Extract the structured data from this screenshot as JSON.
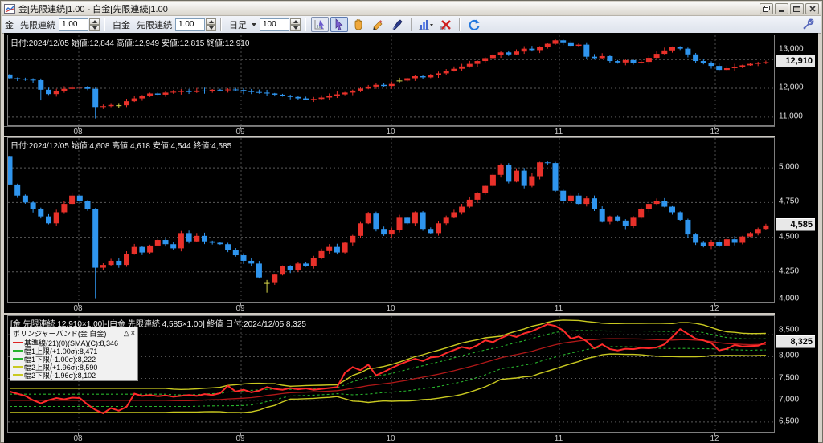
{
  "window": {
    "title": "金[先限連続]1.00 - 白金[先限連続]1.00"
  },
  "toolbar": {
    "gold_label": "金",
    "gold_series": "先限連続",
    "gold_mult": "1.00",
    "plat_label": "白金",
    "plat_series": "先限連続",
    "plat_mult": "1.00",
    "period_label": "日足",
    "bar_count": "100"
  },
  "colors": {
    "up": "#e8312a",
    "down": "#2f95ee",
    "doji": "#d6d64a",
    "spread": "#ff2a2a",
    "sma": "#b01818",
    "band1": "#27b32c",
    "band2": "#c9c920",
    "grid": "#5a5a5a",
    "monthline": "#4a4a4a"
  },
  "chart_data": [
    {
      "type": "candlestick",
      "title": "金 先限連続 日足",
      "info": "日付:2024/12/05 始値:12,844 高値:12,949 安値:12,815 終値:12,910",
      "last_price": 12910,
      "last_price_label": "12,910",
      "ylim": [
        10660,
        13845
      ],
      "y_ticks": [
        {
          "v": 13000,
          "label": "13,000"
        },
        {
          "v": 12000,
          "label": "12,000"
        },
        {
          "v": 11000,
          "label": "11,000"
        }
      ],
      "x_ticks": [
        "08",
        "09",
        "10",
        "11",
        "12"
      ],
      "open_first": 12480,
      "closes": [
        12350,
        12330,
        12300,
        12280,
        11950,
        11800,
        11900,
        11980,
        12020,
        12050,
        11980,
        11350,
        11380,
        11420,
        11410,
        11550,
        11650,
        11750,
        11820,
        11780,
        11850,
        11880,
        11900,
        11870,
        11920,
        11900,
        11950,
        11930,
        11960,
        11940,
        11900,
        11870,
        11850,
        11820,
        11780,
        11740,
        11700,
        11650,
        11600,
        11630,
        11680,
        11730,
        11790,
        11850,
        11920,
        11990,
        12060,
        12120,
        12080,
        12150,
        12270,
        12350,
        12420,
        12380,
        12450,
        12520,
        12600,
        12680,
        12760,
        12850,
        12950,
        13050,
        13150,
        13250,
        13180,
        13280,
        13380,
        13330,
        13450,
        13550,
        13670,
        13600,
        13480,
        13520,
        13100,
        13050,
        13120,
        12950,
        12900,
        12980,
        12890,
        12920,
        13060,
        13200,
        13320,
        13440,
        13380,
        13180,
        12950,
        12870,
        12780,
        12640,
        12700,
        12750,
        12800,
        12850,
        12880,
        12910
      ],
      "dojis": [
        14,
        50
      ],
      "low_overrides": {
        "4": 11580,
        "11": 10950
      },
      "wick_amp": 90
    },
    {
      "type": "candlestick",
      "title": "白金 先限連続 日足",
      "info": "日付:2024/12/05 始値:4,608 高値:4,618 安値:4,544 終値:4,585",
      "last_price": 4585,
      "last_price_label": "4,585",
      "ylim": [
        4023,
        5215
      ],
      "y_ticks": [
        {
          "v": 5000,
          "label": "5,000"
        },
        {
          "v": 4750,
          "label": "4,750"
        },
        {
          "v": 4500,
          "label": "4,500"
        },
        {
          "v": 4250,
          "label": "4,250"
        },
        {
          "v": 4000,
          "label": "4,000"
        }
      ],
      "x_ticks": [
        "08",
        "09",
        "10",
        "11",
        "12"
      ],
      "open_first": 5080,
      "closes": [
        4880,
        4800,
        4750,
        4700,
        4650,
        4600,
        4680,
        4740,
        4800,
        4760,
        4700,
        4280,
        4300,
        4330,
        4300,
        4380,
        4430,
        4390,
        4440,
        4480,
        4450,
        4420,
        4530,
        4470,
        4510,
        4470,
        4460,
        4450,
        4410,
        4370,
        4330,
        4310,
        4210,
        4170,
        4230,
        4290,
        4260,
        4310,
        4290,
        4350,
        4400,
        4430,
        4390,
        4460,
        4510,
        4600,
        4670,
        4560,
        4520,
        4550,
        4640,
        4600,
        4680,
        4560,
        4530,
        4600,
        4640,
        4680,
        4720,
        4770,
        4820,
        4870,
        4950,
        5020,
        4900,
        4980,
        4870,
        4940,
        5040,
        5035,
        4835,
        4760,
        4800,
        4740,
        4780,
        4700,
        4610,
        4650,
        4620,
        4580,
        4640,
        4700,
        4740,
        4760,
        4720,
        4680,
        4625,
        4520,
        4460,
        4435,
        4465,
        4440,
        4485,
        4460,
        4505,
        4530,
        4560,
        4585
      ],
      "dojis": [
        33
      ],
      "low_overrides": {
        "11": 4060,
        "33": 4100
      },
      "wick_amp": 20
    },
    {
      "type": "line",
      "title": "金-白金 スプレッド ボリンジャーバンド",
      "info": "[金 先限連続 12,910×1.00]-[白金 先限連続 4,585×1.00] 終値 日付:2024/12/05 8,325",
      "last_price": 8325,
      "last_price_label": "8,325",
      "ylim": [
        6241,
        8926
      ],
      "y_ticks": [
        {
          "v": 8500,
          "label": "8,500"
        },
        {
          "v": 8000,
          "label": "8,000"
        },
        {
          "v": 7500,
          "label": "7,500"
        },
        {
          "v": 7000,
          "label": "7,000"
        },
        {
          "v": 6500,
          "label": "6,500"
        }
      ],
      "x_ticks": [
        "08",
        "09",
        "10",
        "11",
        "12"
      ],
      "values": [
        7200,
        7150,
        7100,
        7000,
        6930,
        7000,
        7050,
        7020,
        7060,
        7050,
        6900,
        6780,
        6700,
        6820,
        6760,
        6850,
        7150,
        7100,
        7120,
        7090,
        7110,
        7080,
        7100,
        7120,
        7100,
        7140,
        7120,
        7160,
        7330,
        7200,
        7240,
        7180,
        7220,
        7300,
        7260,
        7240,
        7280,
        7250,
        7270,
        7240,
        7260,
        7280,
        7300,
        7630,
        7760,
        7690,
        7815,
        7570,
        7650,
        7740,
        7820,
        7890,
        7950,
        7900,
        7980,
        8000,
        8080,
        8150,
        8220,
        8180,
        8260,
        8370,
        8330,
        8420,
        8500,
        8450,
        8530,
        8580,
        8660,
        8740,
        8700,
        8600,
        8410,
        8460,
        8350,
        8190,
        8280,
        8170,
        8140,
        8180,
        8170,
        8200,
        8190,
        8210,
        8280,
        8450,
        8630,
        8520,
        8410,
        8370,
        8310,
        8140,
        8180,
        8265,
        8230,
        8240,
        8250,
        8325
      ],
      "indicator": {
        "name": "ボリンジャーバンド",
        "period": 21,
        "k1": 1.0,
        "k2": 1.96
      },
      "legend": {
        "title": "ボリンジャーバンド(金 白金)",
        "collapse_glyph": "△",
        "close_glyph": "×",
        "items": [
          {
            "color": "#dd2222",
            "label": "基準線(21)(0)(SMA)(C):8,346"
          },
          {
            "color": "#27b32c",
            "label": "幅1上限(+1.00σ):8,471"
          },
          {
            "color": "#27b32c",
            "label": "幅1下限(-1.00σ):8,222"
          },
          {
            "color": "#c9c920",
            "label": "幅2上限(+1.96σ):8,590"
          },
          {
            "color": "#c9c920",
            "label": "幅2下限(-1.96σ):8,102"
          }
        ]
      }
    }
  ]
}
